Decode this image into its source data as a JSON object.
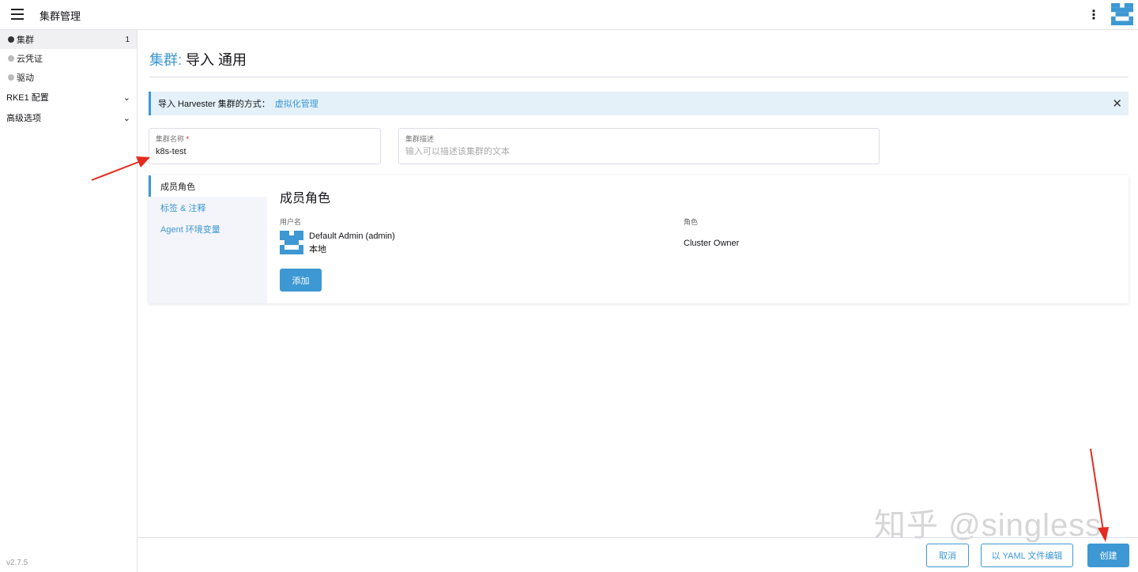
{
  "header": {
    "title": "集群管理"
  },
  "sidebar": {
    "items": [
      {
        "label": "集群",
        "count": "1"
      },
      {
        "label": "云凭证"
      },
      {
        "label": "驱动"
      }
    ],
    "groups": [
      {
        "label": "RKE1 配置"
      },
      {
        "label": "高级选项"
      }
    ],
    "version": "v2.7.5"
  },
  "page": {
    "title_prefix": "集群:",
    "title_rest": "导入 通用"
  },
  "banner": {
    "text": "导入 Harvester 集群的方式：",
    "link": "虚拟化管理"
  },
  "form": {
    "name_label": "集群名称",
    "required": "*",
    "name_value": "k8s-test",
    "desc_label": "集群描述",
    "desc_placeholder": "输入可以描述该集群的文本"
  },
  "tabs": [
    {
      "label": "成员角色"
    },
    {
      "label": "标签 & 注释"
    },
    {
      "label": "Agent 环境变量"
    }
  ],
  "members": {
    "heading": "成员角色",
    "col_user": "用户名",
    "col_role": "角色",
    "user_name": "Default Admin (admin)",
    "user_source": "本地",
    "role": "Cluster Owner",
    "add_label": "添加"
  },
  "footer": {
    "cancel": "取消",
    "yaml": "以 YAML 文件编辑",
    "create": "创建"
  },
  "watermark": "知乎 @singless",
  "colors": {
    "accent": "#3d98d3",
    "banner_bg": "#e4f1f9"
  }
}
